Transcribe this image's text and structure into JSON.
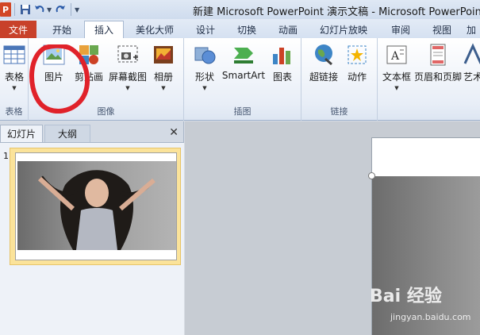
{
  "window": {
    "title": "新建 Microsoft PowerPoint 演示文稿 - Microsoft PowerPoint",
    "app_icon": "P"
  },
  "tabs": [
    {
      "label": "文件"
    },
    {
      "label": "开始"
    },
    {
      "label": "插入"
    },
    {
      "label": "美化大师"
    },
    {
      "label": "设计"
    },
    {
      "label": "切换"
    },
    {
      "label": "动画"
    },
    {
      "label": "幻灯片放映"
    },
    {
      "label": "审阅"
    },
    {
      "label": "视图"
    },
    {
      "label": "加"
    }
  ],
  "ribbon": {
    "groups": [
      {
        "label": "表格",
        "buttons": [
          "表格"
        ]
      },
      {
        "label": "图像",
        "buttons": [
          "图片",
          "剪贴画",
          "屏幕截图",
          "相册"
        ]
      },
      {
        "label": "插图",
        "buttons": [
          "形状",
          "SmartArt",
          "图表"
        ]
      },
      {
        "label": "链接",
        "buttons": [
          "超链接",
          "动作"
        ]
      },
      {
        "label": "",
        "buttons": [
          "文本框",
          "页眉和页脚",
          "艺术"
        ]
      }
    ]
  },
  "panel": {
    "tab_slides": "幻灯片",
    "tab_outline": "大纲",
    "close": "✕",
    "slide_number": "1"
  },
  "watermark": {
    "logo": "Bai 经验",
    "url": "jingyan.baidu.com"
  },
  "colors": {
    "file_tab": "#c8412a",
    "annotation": "#e0222a"
  }
}
